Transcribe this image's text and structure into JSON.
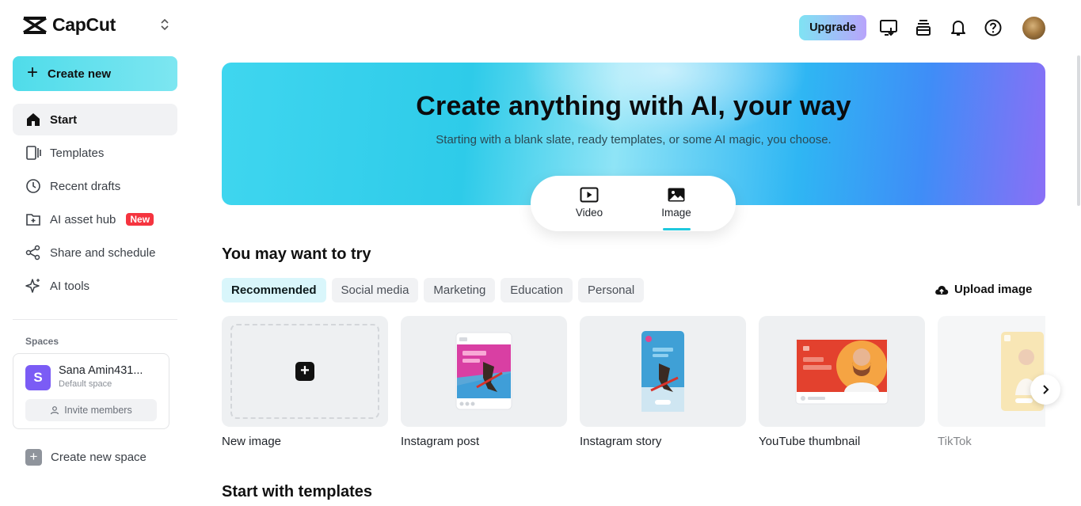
{
  "app": {
    "logo_text": "CapCut"
  },
  "sidebar": {
    "create_label": "Create new",
    "items": [
      {
        "label": "Start",
        "icon": "home-icon",
        "active": true
      },
      {
        "label": "Templates",
        "icon": "templates-icon"
      },
      {
        "label": "Recent drafts",
        "icon": "clock-icon"
      },
      {
        "label": "AI asset hub",
        "icon": "asset-hub-icon",
        "badge": "New"
      },
      {
        "label": "Share and schedule",
        "icon": "share-icon"
      },
      {
        "label": "AI tools",
        "icon": "sparkle-icon"
      }
    ],
    "spaces_label": "Spaces",
    "space": {
      "avatar_letter": "S",
      "name": "Sana Amin431...",
      "sub": "Default space",
      "invite_label": "Invite members"
    },
    "create_space_label": "Create new space"
  },
  "header": {
    "upgrade_label": "Upgrade",
    "icons": [
      "download-desktop-icon",
      "layers-icon",
      "bell-icon",
      "help-icon"
    ]
  },
  "hero": {
    "title": "Create anything with AI, your way",
    "subtitle": "Starting with a blank slate, ready templates, or some AI magic, you choose.",
    "modes": [
      {
        "label": "Video",
        "icon": "video-icon"
      },
      {
        "label": "Image",
        "icon": "image-icon",
        "selected": true
      }
    ]
  },
  "try_section": {
    "title": "You may want to try",
    "chips": [
      {
        "label": "Recommended",
        "active": true
      },
      {
        "label": "Social media"
      },
      {
        "label": "Marketing"
      },
      {
        "label": "Education"
      },
      {
        "label": "Personal"
      }
    ],
    "upload_label": "Upload image",
    "cards": [
      {
        "label": "New image"
      },
      {
        "label": "Instagram post"
      },
      {
        "label": "Instagram story"
      },
      {
        "label": "YouTube thumbnail"
      },
      {
        "label": "TikTok"
      }
    ]
  },
  "templates_section": {
    "title": "Start with templates"
  },
  "colors": {
    "accent_cyan": "#4fdcea",
    "badge_red": "#f5343f",
    "space_purple": "#7b5cf5",
    "hero_violet": "#8a6ff6"
  }
}
